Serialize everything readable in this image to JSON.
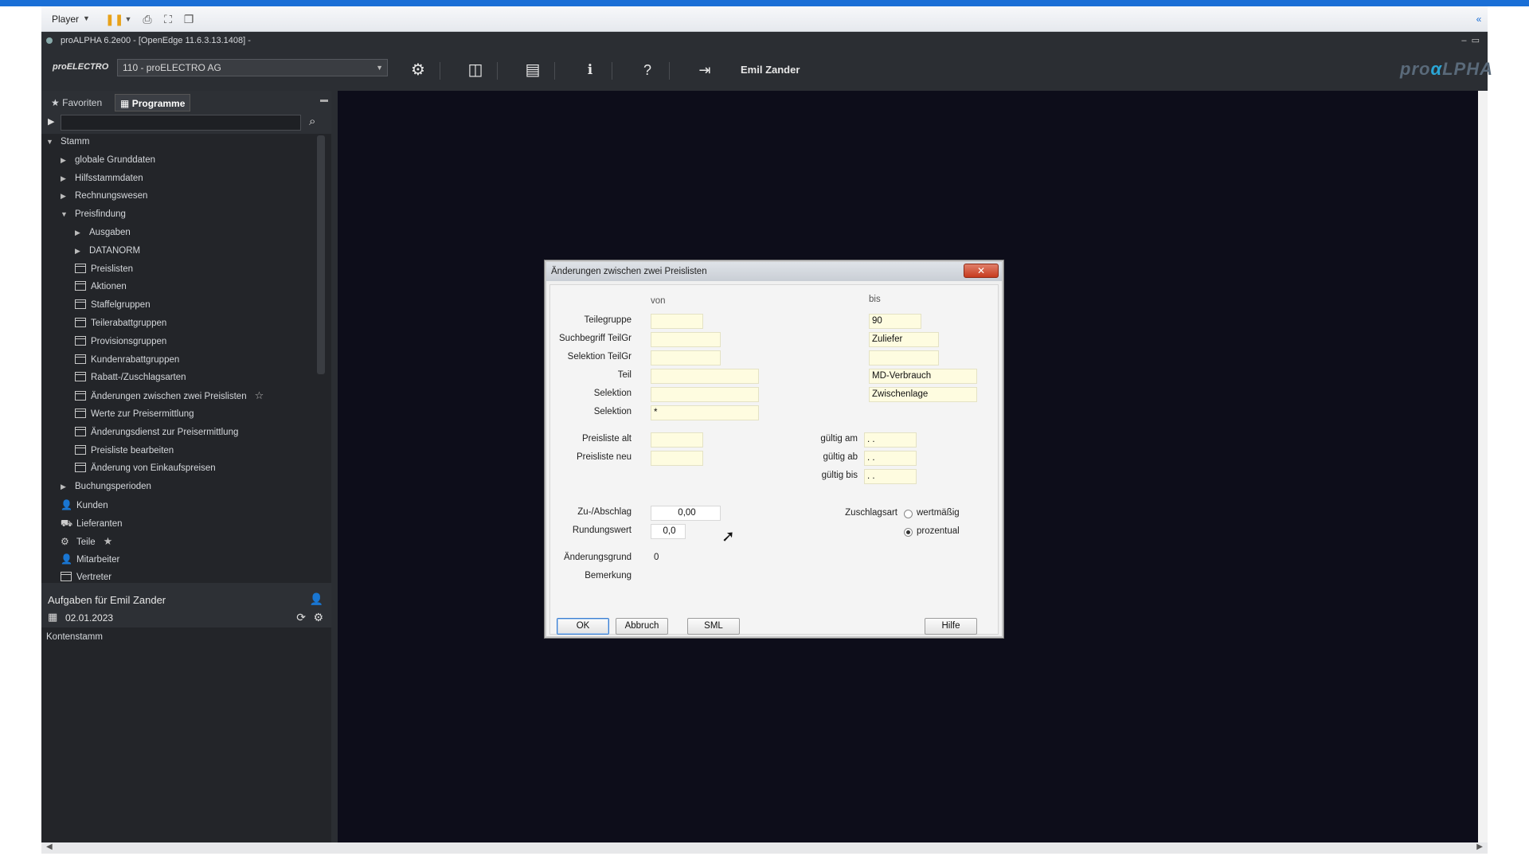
{
  "player": {
    "label": "Player"
  },
  "app": {
    "window_title": "proALPHA 6.2e00 - [OpenEdge 11.6.3.13.1408] -",
    "brand": "proELECTRO",
    "mandant": "110 - proELECTRO AG",
    "user": "Emil Zander",
    "logo": "proALPHA"
  },
  "sidebar": {
    "tabs": [
      {
        "label": "Favoriten",
        "icon": "star-icon"
      },
      {
        "label": "Programme",
        "icon": "programs-icon"
      }
    ],
    "search_value": "",
    "tree": [
      {
        "label": "Stamm",
        "level": 0,
        "toggle": "expanded"
      },
      {
        "label": "globale Grunddaten",
        "level": 1,
        "toggle": "collapsed"
      },
      {
        "label": "Hilfsstammdaten",
        "level": 1,
        "toggle": "collapsed"
      },
      {
        "label": "Rechnungswesen",
        "level": 1,
        "toggle": "collapsed"
      },
      {
        "label": "Preisfindung",
        "level": 1,
        "toggle": "expanded"
      },
      {
        "label": "Ausgaben",
        "level": 2,
        "toggle": "collapsed"
      },
      {
        "label": "DATANORM",
        "level": 2,
        "toggle": "collapsed"
      },
      {
        "label": "Preislisten",
        "level": 2,
        "icon": "form-icon"
      },
      {
        "label": "Aktionen",
        "level": 2,
        "icon": "form-icon"
      },
      {
        "label": "Staffelgruppen",
        "level": 2,
        "icon": "form-icon"
      },
      {
        "label": "Teilerabattgruppen",
        "level": 2,
        "icon": "form-icon"
      },
      {
        "label": "Provisionsgruppen",
        "level": 2,
        "icon": "form-icon"
      },
      {
        "label": "Kundenrabattgruppen",
        "level": 2,
        "icon": "form-icon"
      },
      {
        "label": "Rabatt-/Zuschlagsarten",
        "level": 2,
        "icon": "form-icon"
      },
      {
        "label": "Änderungen zwischen zwei Preislisten",
        "level": 2,
        "icon": "form-icon",
        "starred": true
      },
      {
        "label": "Werte zur Preisermittlung",
        "level": 2,
        "icon": "form-icon"
      },
      {
        "label": "Änderungsdienst zur Preisermittlung",
        "level": 2,
        "icon": "form-icon"
      },
      {
        "label": "Preisliste bearbeiten",
        "level": 2,
        "icon": "form-icon"
      },
      {
        "label": "Änderung von Einkaufspreisen",
        "level": 2,
        "icon": "form-icon"
      },
      {
        "label": "Buchungsperioden",
        "level": 1,
        "toggle": "collapsed"
      },
      {
        "label": "Kunden",
        "level": 1,
        "icon": "person-icon"
      },
      {
        "label": "Lieferanten",
        "level": 1,
        "icon": "supplier-icon"
      },
      {
        "label": "Teile",
        "level": 1,
        "icon": "parts-icon",
        "starred": true
      },
      {
        "label": "Mitarbeiter",
        "level": 1,
        "icon": "person-icon"
      },
      {
        "label": "Vertreter",
        "level": 1,
        "icon": "form-icon"
      }
    ]
  },
  "tasks": {
    "title": "Aufgaben für Emil Zander",
    "date": "02.01.2023"
  },
  "recent": {
    "item": "Kontenstamm"
  },
  "dialog": {
    "title": "Änderungen zwischen zwei Preislisten",
    "col_from": "von",
    "col_to": "bis",
    "labels": {
      "teilegruppe": "Teilegruppe",
      "suchbegriff": "Suchbegriff TeilGr",
      "selektion_teilgr": "Selektion TeilGr",
      "teil": "Teil",
      "selektion1": "Selektion",
      "selektion2": "Selektion",
      "preisliste_alt": "Preisliste alt",
      "preisliste_neu": "Preisliste neu",
      "gueltig_am": "gültig am",
      "gueltig_ab": "gültig ab",
      "gueltig_bis": "gültig bis",
      "zu_abschlag": "Zu-/Abschlag",
      "rundungswert": "Rundungswert",
      "aenderungsgrund": "Änderungsgrund",
      "bemerkung": "Bemerkung",
      "zuschlagsart": "Zuschlagsart"
    },
    "values": {
      "teilegruppe_from": "",
      "teilegruppe_to": "90",
      "suchbegriff_from": "",
      "suchbegriff_to": "Zuliefer",
      "selektion_teilgr_from": "",
      "selektion_teilgr_to": "",
      "teil_from": "",
      "teil_to": "MD-Verbrauch",
      "selektion1_from": "",
      "selektion1_to": "Zwischenlage",
      "selektion2_from": "*",
      "preisliste_alt": "",
      "preisliste_neu": "",
      "gueltig_am": ". .",
      "gueltig_ab": ". .",
      "gueltig_bis": ". .",
      "zu_abschlag": "0,00",
      "rundungswert": "0,0",
      "aenderungsgrund": "0"
    },
    "radio": {
      "wert": "wertmäßig",
      "proz": "prozentual",
      "selected": "prozentual"
    },
    "buttons": {
      "ok": "OK",
      "abbruch": "Abbruch",
      "sml": "SML",
      "hilfe": "Hilfe"
    }
  }
}
